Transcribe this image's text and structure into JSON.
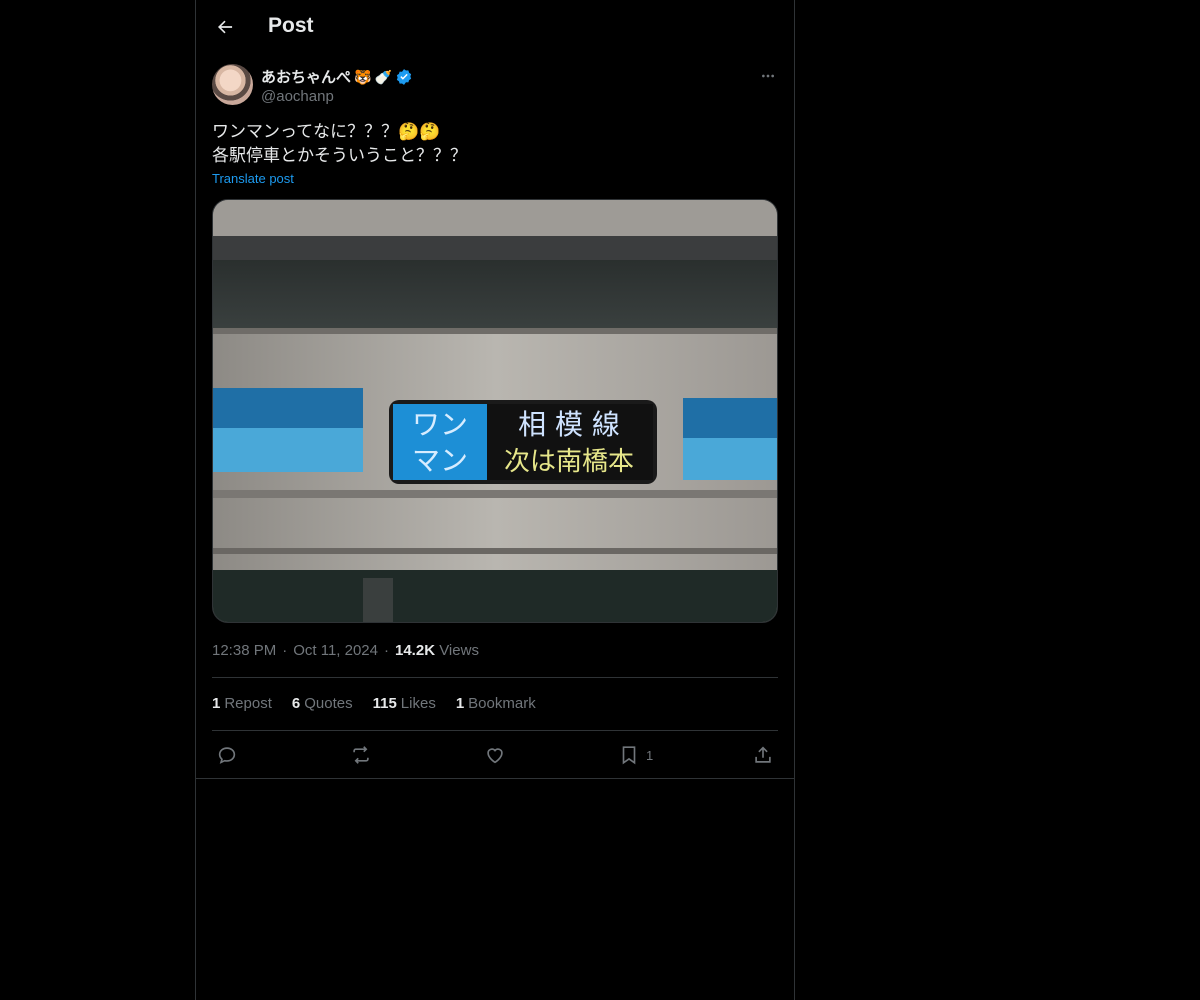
{
  "header": {
    "title": "Post",
    "back_icon": "arrow-left-icon"
  },
  "post": {
    "author": {
      "name": "あおちゃんぺ",
      "emojis": [
        "🐯",
        "🍼"
      ],
      "handle": "@aochanp",
      "verified": true
    },
    "text_lines": [
      "ワンマンってなに？？？🤔🤔",
      "各駅停車とかそういうこと？？？"
    ],
    "translate_label": "Translate post",
    "media": {
      "sign_left": [
        "ワン",
        "マン"
      ],
      "sign_right_top": "相 模 線",
      "sign_right_bottom": "次は南橋本"
    },
    "time": "12:38 PM",
    "date": "Oct 11, 2024",
    "views_count": "14.2K",
    "views_label": "Views",
    "separator": "·"
  },
  "stats": {
    "reposts": {
      "count": "1",
      "label": "Repost"
    },
    "quotes": {
      "count": "6",
      "label": "Quotes"
    },
    "likes": {
      "count": "115",
      "label": "Likes"
    },
    "bookmarks": {
      "count": "1",
      "label": "Bookmark"
    }
  },
  "actions": {
    "reply": {
      "icon": "reply-icon"
    },
    "repost": {
      "icon": "repost-icon"
    },
    "like": {
      "icon": "heart-icon"
    },
    "bookmark": {
      "icon": "bookmark-icon",
      "count": "1"
    },
    "share": {
      "icon": "share-icon"
    }
  },
  "colors": {
    "background": "#000000",
    "text": "#e7e9ea",
    "muted": "#71767b",
    "link": "#1d9bf0",
    "border": "#2f3336",
    "verified": "#1d9bf0"
  }
}
